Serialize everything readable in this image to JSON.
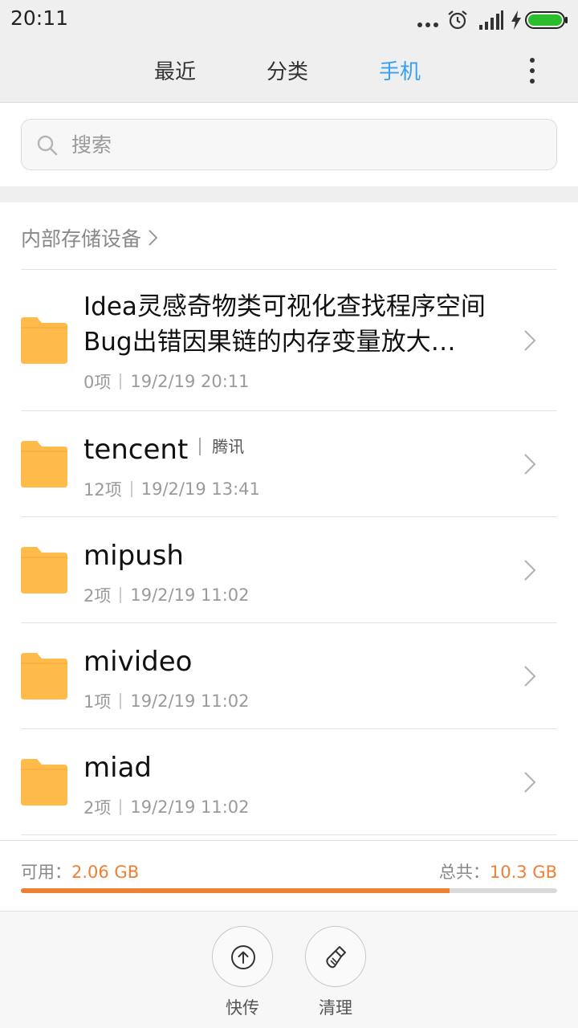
{
  "status_bar": {
    "time": "20:11",
    "icons": [
      "more-dots-icon",
      "alarm-icon",
      "signal-icon",
      "charging-bolt-icon",
      "battery-icon"
    ],
    "battery_color": "#2bbd2b"
  },
  "tabs": [
    {
      "label": "最近",
      "active": false
    },
    {
      "label": "分类",
      "active": false
    },
    {
      "label": "手机",
      "active": true
    }
  ],
  "accent_color": "#37a0f0",
  "search": {
    "placeholder": "搜索"
  },
  "breadcrumb": {
    "label": "内部存储设备"
  },
  "folders": [
    {
      "name": "Idea灵感奇物类可视化查找程序空间Bug出错因果链的内存变量放大…",
      "tag": "",
      "count": "0项",
      "date": "19/2/19 20:11"
    },
    {
      "name": "tencent",
      "tag": "腾讯",
      "count": "12项",
      "date": "19/2/19 13:41"
    },
    {
      "name": "mipush",
      "tag": "",
      "count": "2项",
      "date": "19/2/19 11:02"
    },
    {
      "name": "mivideo",
      "tag": "",
      "count": "1项",
      "date": "19/2/19 11:02"
    },
    {
      "name": "miad",
      "tag": "",
      "count": "2项",
      "date": "19/2/19 11:02"
    }
  ],
  "folder_color": "#ffbb4a",
  "storage": {
    "available_label": "可用：",
    "available_value": "2.06 GB",
    "total_label": "总共：",
    "total_value": "10.3 GB",
    "used_fraction": 0.8,
    "accent_color": "#ee7f33"
  },
  "actions": [
    {
      "label": "快传",
      "icon": "upload-icon"
    },
    {
      "label": "清理",
      "icon": "broom-icon"
    }
  ]
}
